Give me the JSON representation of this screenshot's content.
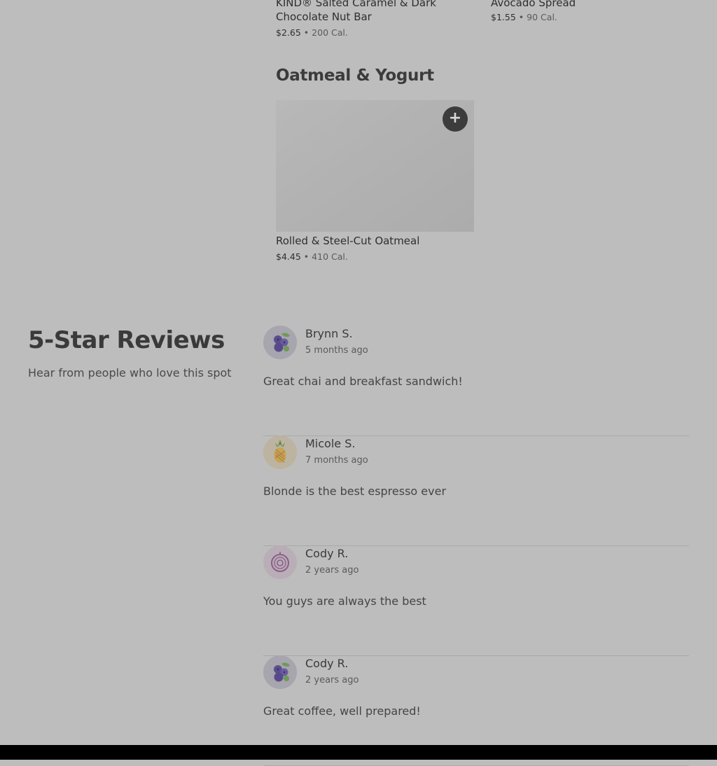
{
  "menu": {
    "top_items": [
      {
        "name": "KIND® Salted Caramel & Dark Chocolate Nut Bar",
        "price": "$2.65",
        "separator": "•",
        "calories": "200 Cal."
      },
      {
        "name": "Avocado Spread",
        "price": "$1.55",
        "separator": "•",
        "calories": "90 Cal."
      }
    ],
    "section": {
      "title": "Oatmeal & Yogurt",
      "item": {
        "name": "Rolled & Steel-Cut Oatmeal",
        "price": "$4.45",
        "separator": "•",
        "calories": "410 Cal.",
        "add_icon": "plus-icon",
        "add_label": "+"
      }
    }
  },
  "reviews": {
    "title": "5-Star Reviews",
    "subtitle": "Hear from people who love this spot",
    "items": [
      {
        "name": "Brynn S.",
        "time": "5 months ago",
        "text": "Great chai and breakfast sandwich!",
        "avatar_icon": "blueberries-icon",
        "avatar_bg": "#a7a5ad"
      },
      {
        "name": "Micole S.",
        "time": "7 months ago",
        "text": "Blonde is the best espresso ever",
        "avatar_icon": "pineapple-icon",
        "avatar_bg": "#bcb3a1"
      },
      {
        "name": "Cody R.",
        "time": "2 years ago",
        "text": "You guys are always the best",
        "avatar_icon": "onion-icon",
        "avatar_bg": "#b9aeb8"
      },
      {
        "name": "Cody R.",
        "time": "2 years ago",
        "text": "Great coffee, well prepared!",
        "avatar_icon": "blueberries-icon",
        "avatar_bg": "#a7a5ad"
      }
    ]
  },
  "colors": {
    "overlay_bg": "#bdbdbd",
    "button_bg": "#3c3c3c",
    "divider": "#a9a9a9"
  }
}
